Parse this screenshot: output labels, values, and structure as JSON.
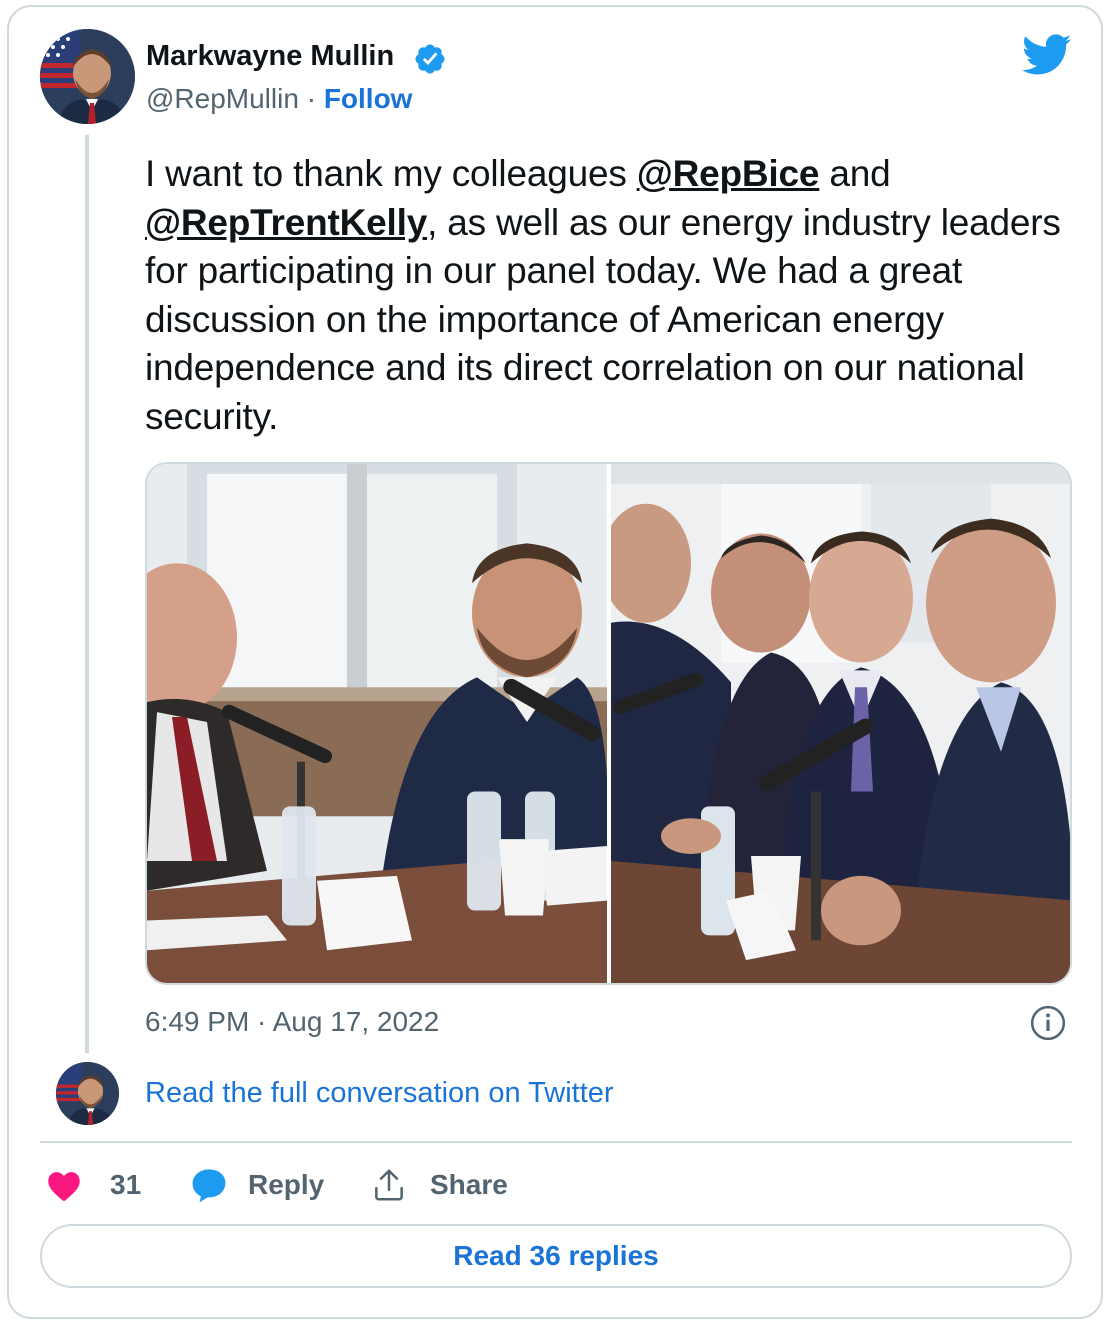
{
  "author": {
    "name": "Markwayne Mullin",
    "handle": "@RepMullin",
    "separator": "·",
    "follow_label": "Follow"
  },
  "tweet": {
    "segments": [
      {
        "text": "I want to thank my colleagues ",
        "mention": false
      },
      {
        "text": "@RepBice",
        "mention": true
      },
      {
        "text": " and ",
        "mention": false
      },
      {
        "text": "@RepTrentKelly",
        "mention": true
      },
      {
        "text": ", as well as our energy industry leaders for participating in our panel today. We had a great discussion on the importance of American energy independence and its direct correlation on our national security.",
        "mention": false
      }
    ]
  },
  "timestamp": "6:49 PM · Aug 17, 2022",
  "conversation_link": "Read the full conversation on Twitter",
  "actions": {
    "like_count": "31",
    "reply_label": "Reply",
    "share_label": "Share"
  },
  "read_replies_label": "Read 36 replies",
  "icons": {
    "verified": "verified-badge-icon",
    "logo": "twitter-bird-icon",
    "info": "info-icon",
    "like": "heart-icon",
    "reply": "speech-bubble-icon",
    "share": "share-upload-icon"
  },
  "colors": {
    "link": "#1a73d6",
    "twitter_blue": "#1d9bf0",
    "like": "#f91880",
    "muted": "#536471",
    "border": "#cfd9de"
  }
}
